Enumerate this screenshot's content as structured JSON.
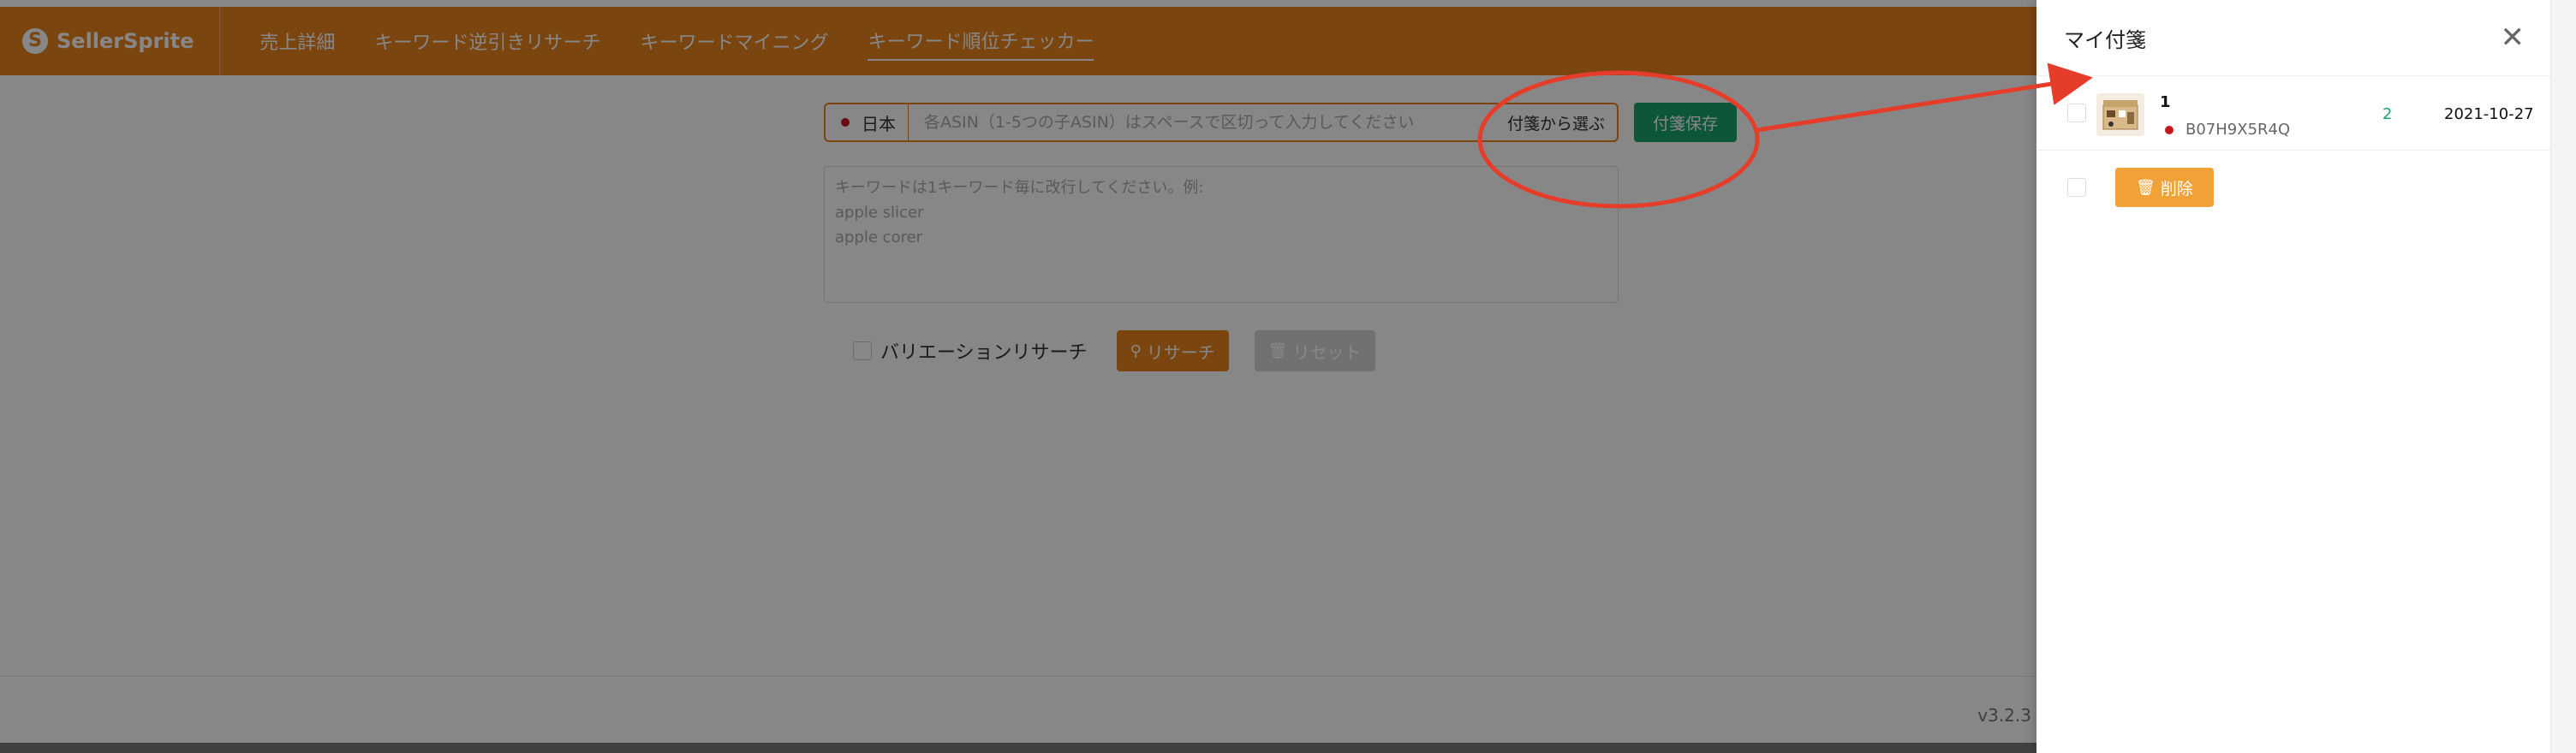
{
  "app": {
    "logo_text": "SellerSprite",
    "nav": [
      "売上詳細",
      "キーワード逆引きリサーチ",
      "キーワードマイニング",
      "キーワード順位チェッカー"
    ],
    "active_nav_index": 3
  },
  "search": {
    "market_label": "日本",
    "asin_placeholder": "各ASIN（1-5つの子ASIN）はスペースで区切って入力してください",
    "pick_note_label": "付箋から選ぶ",
    "save_note_label": "付箋保存"
  },
  "keywords": {
    "placeholder_lines": [
      "キーワードは1キーワード毎に改行してください。例:",
      "apple slicer",
      "apple corer"
    ]
  },
  "options": {
    "variation_label": "バリエーションリサーチ",
    "search_button": "リサーチ",
    "reset_button": "リセット"
  },
  "footer": {
    "version": "v3.2.3"
  },
  "drawer": {
    "title": "マイ付箋",
    "item": {
      "name": "1",
      "asin": "B07H9X5R4Q",
      "count": "2",
      "date": "2021-10-27"
    },
    "delete_button": "削除"
  },
  "colors": {
    "brand": "#e8821f",
    "save_green": "#1ba36f",
    "annotation_red": "#e53d2a"
  },
  "icons": {
    "logo": "sellersprite-logo-icon",
    "search": "search-icon",
    "reset": "trash-icon",
    "delete": "trash-icon",
    "close": "close-icon"
  }
}
